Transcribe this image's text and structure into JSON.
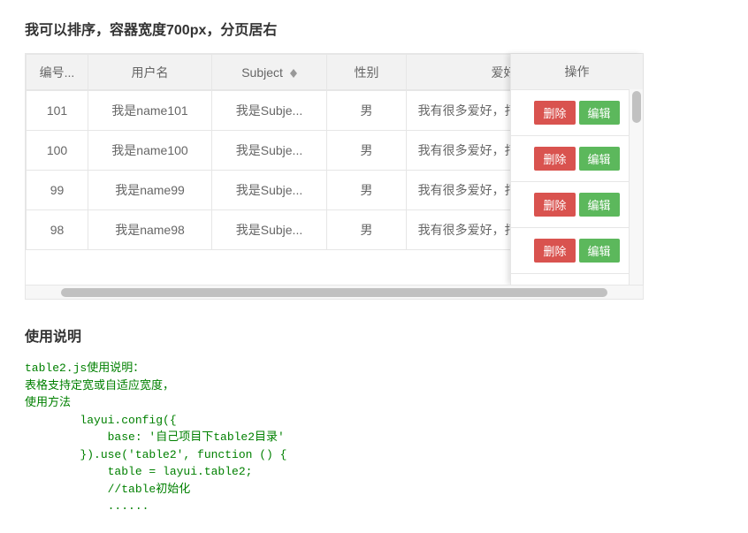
{
  "page_title": "我可以排序，容器宽度700px，分页居右",
  "columns": {
    "id": "编号...",
    "username": "用户名",
    "subject": "Subject",
    "gender": "性别",
    "hobby": "爱好",
    "op": "操作"
  },
  "buttons": {
    "delete": "删除",
    "edit": "编辑"
  },
  "rows": [
    {
      "id": "101",
      "username": "我是name101",
      "subject": "我是Subje...",
      "gender": "男",
      "hobby": "我有很多爱好，打羽毛球，打..."
    },
    {
      "id": "100",
      "username": "我是name100",
      "subject": "我是Subje...",
      "gender": "男",
      "hobby": "我有很多爱好，打羽毛球，打..."
    },
    {
      "id": "99",
      "username": "我是name99",
      "subject": "我是Subje...",
      "gender": "男",
      "hobby": "我有很多爱好，打羽毛球，打..."
    },
    {
      "id": "98",
      "username": "我是name98",
      "subject": "我是Subje...",
      "gender": "男",
      "hobby": "我有很多爱好，打羽毛球，打..."
    }
  ],
  "usage_heading": "使用说明",
  "usage_code": "table2.js使用说明：\n表格支持定宽或自适应宽度，\n使用方法\n        layui.config({\n            base: '自己项目下table2目录'\n        }).use('table2', function () {\n            table = layui.table2;\n            //table初始化\n            ......"
}
